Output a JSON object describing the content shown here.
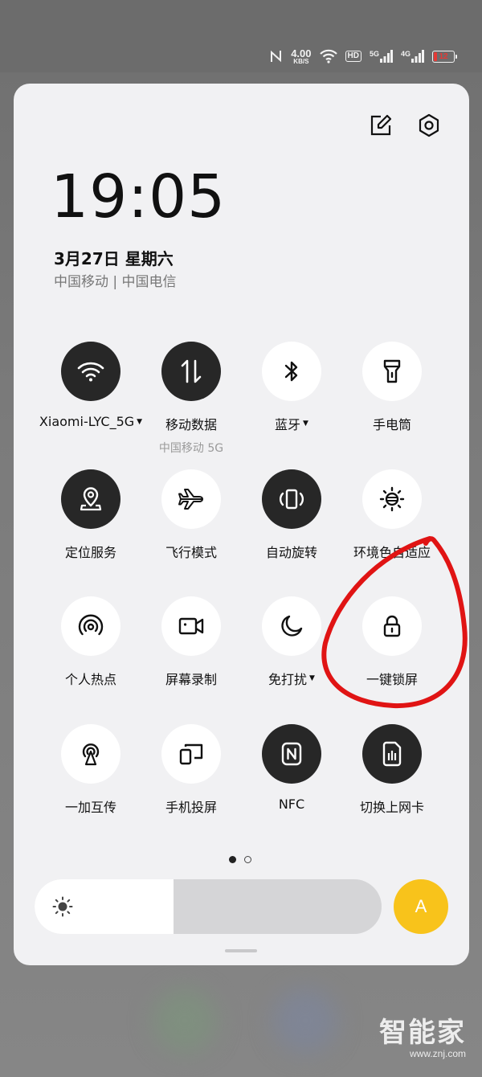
{
  "status_bar": {
    "speed_value": "4.00",
    "speed_unit": "KB/S",
    "hd_label": "HD",
    "sim1_type": "5G",
    "sim2_type": "4G",
    "battery_level": "12",
    "battery_color": "#e53935"
  },
  "header": {
    "time": "19:05",
    "date": "3月27日  星期六",
    "carriers": "中国移动 | 中国电信",
    "edit_icon": "edit-icon",
    "settings_icon": "gear-icon"
  },
  "tiles": [
    {
      "label": "Xiaomi-LYC_5G",
      "dropdown": true,
      "state": "on",
      "icon": "wifi-icon"
    },
    {
      "label": "移动数据",
      "sub": "中国移动 5G",
      "state": "on",
      "icon": "mobile-data-icon"
    },
    {
      "label": "蓝牙",
      "dropdown": true,
      "state": "off",
      "icon": "bluetooth-icon"
    },
    {
      "label": "手电筒",
      "state": "off",
      "icon": "flashlight-icon"
    },
    {
      "label": "定位服务",
      "state": "on",
      "icon": "location-icon"
    },
    {
      "label": "飞行模式",
      "state": "off",
      "icon": "airplane-icon"
    },
    {
      "label": "自动旋转",
      "state": "on",
      "icon": "auto-rotate-icon"
    },
    {
      "label": "环境色自适应",
      "state": "off",
      "icon": "ambient-color-icon"
    },
    {
      "label": "个人热点",
      "state": "off",
      "icon": "hotspot-icon"
    },
    {
      "label": "屏幕录制",
      "state": "off",
      "icon": "screen-record-icon"
    },
    {
      "label": "免打扰",
      "dropdown": true,
      "state": "off",
      "icon": "moon-icon"
    },
    {
      "label": "一键锁屏",
      "state": "off",
      "icon": "lock-icon"
    },
    {
      "label": "一加互传",
      "state": "off",
      "icon": "share-icon"
    },
    {
      "label": "手机投屏",
      "state": "off",
      "icon": "cast-icon"
    },
    {
      "label": "NFC",
      "state": "on",
      "icon": "nfc-icon"
    },
    {
      "label": "切换上网卡",
      "state": "on",
      "icon": "sim-card-icon"
    }
  ],
  "pager": {
    "pages": 2,
    "current": 1
  },
  "brightness": {
    "level": 0.4,
    "icon": "sun-icon"
  },
  "auto_brightness": {
    "label": "A",
    "color": "#f8c31b"
  },
  "annotation": {
    "color": "#e01414",
    "target": "一键锁屏"
  },
  "watermark": {
    "brand": "智能家",
    "url": "www.znj.com"
  }
}
